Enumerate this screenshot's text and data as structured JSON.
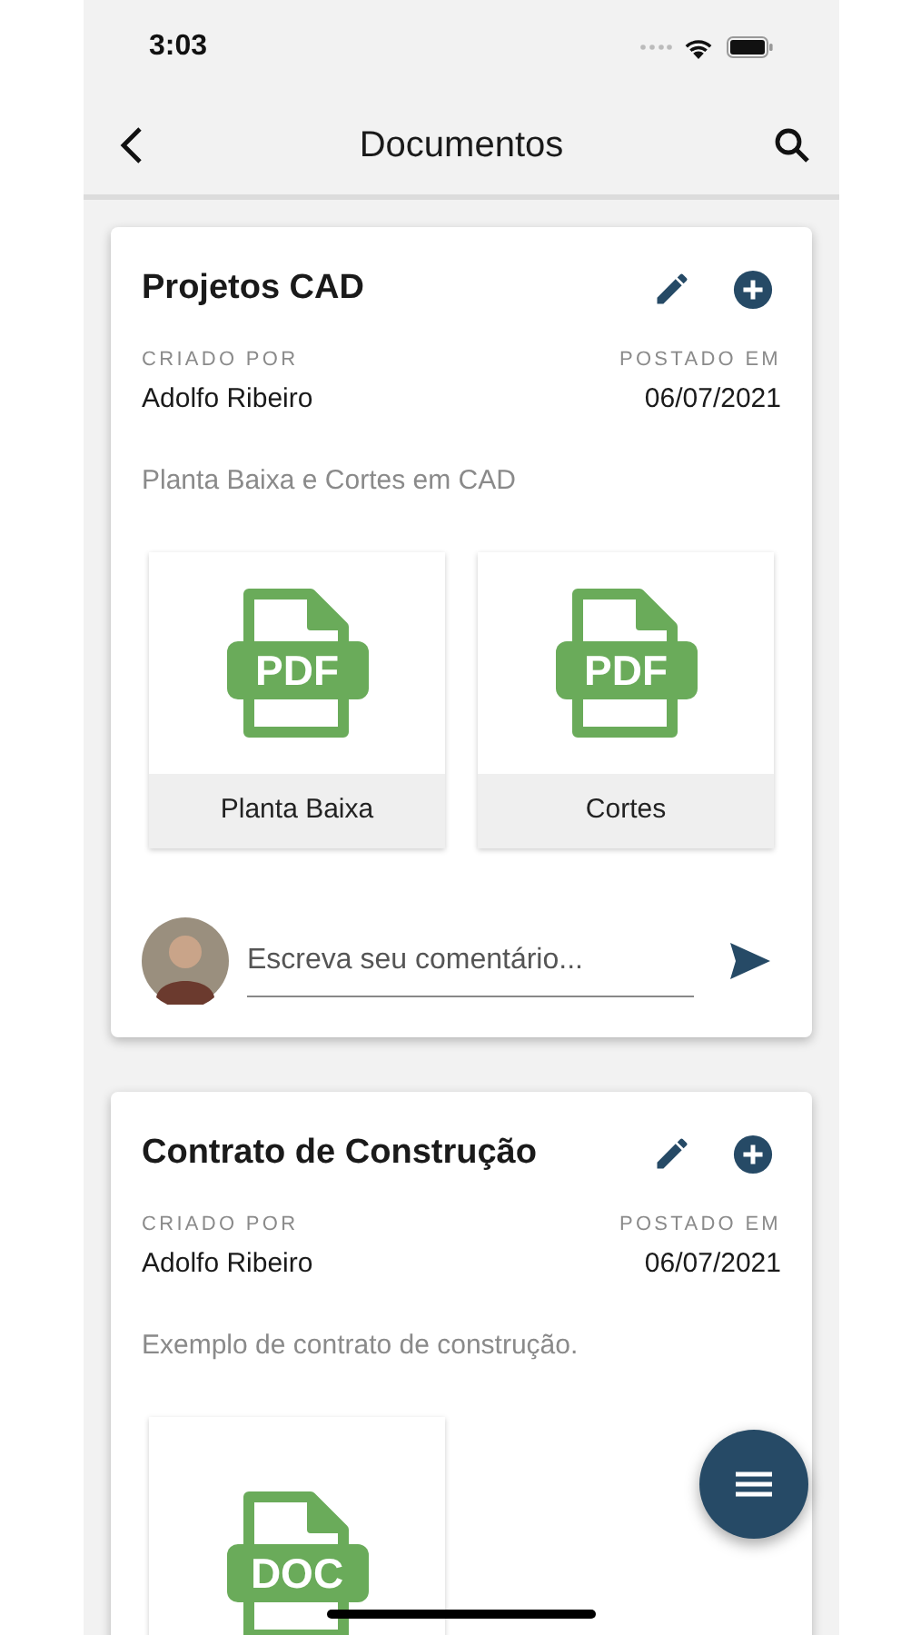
{
  "status_bar": {
    "time": "3:03"
  },
  "nav_bar": {
    "title": "Documentos"
  },
  "cards": [
    {
      "title": "Projetos CAD",
      "created_by_label": "CRIADO POR",
      "author": "Adolfo Ribeiro",
      "posted_label": "POSTADO EM",
      "date": "06/07/2021",
      "description": "Planta Baixa e Cortes em CAD",
      "attachments": [
        {
          "type": "PDF",
          "name": "Planta Baixa"
        },
        {
          "type": "PDF",
          "name": "Cortes"
        }
      ],
      "comment": {
        "placeholder": "Escreva seu comentário..."
      }
    },
    {
      "title": "Contrato de Construção",
      "created_by_label": "CRIADO POR",
      "author": "Adolfo Ribeiro",
      "posted_label": "POSTADO EM",
      "date": "06/07/2021",
      "description": "Exemplo de contrato de construção.",
      "attachments": [
        {
          "type": "DOC"
        }
      ]
    }
  ]
}
